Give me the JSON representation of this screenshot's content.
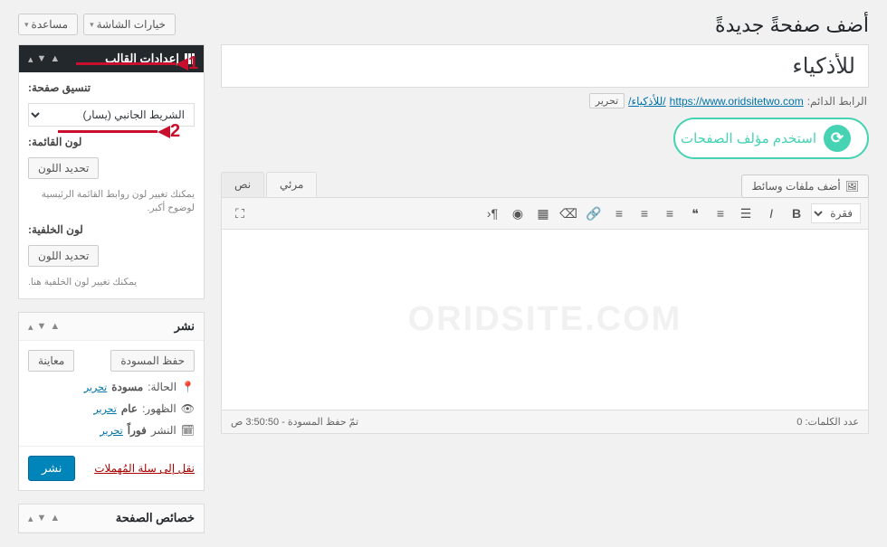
{
  "header": {
    "title_heading": "أضف صفحةً جديدةً",
    "top_buttons": [
      "خيارات الشاشة",
      "مساعدة"
    ]
  },
  "title": {
    "value": "للأذكياء"
  },
  "permalink": {
    "label": "الرابط الدائم:",
    "base_url": "https://www.oridsitetwo.com",
    "slug": "/للأذكياء/",
    "edit_label": "تحرير"
  },
  "builder": {
    "label": "استخدم مؤلف الصفحات"
  },
  "media_button": "أضف ملفات وسائط",
  "editor": {
    "tabs": {
      "visual": "مرئي",
      "text": "نص"
    },
    "format_dropdown": "فقرة",
    "watermark": "ORIDSITE.COM",
    "status": {
      "word_count_label": "عدد الكلمات:",
      "word_count": "0",
      "autosave": "تمّ حفظ المسودة - 3:50:50 ص"
    }
  },
  "sidebar": {
    "theme_settings": {
      "title": "إعدادات القالب",
      "layout_label": "تنسيق صفحة:",
      "layout_option": "الشريط الجانبي (يسار)",
      "menu_color_label": "لون القائمة:",
      "menu_color_button": "تحديد اللون",
      "menu_hint": "يمكنك تغيير لون روابط القائمة الرئيسية لوضوح أكبر.",
      "bg_color_label": "لون الخلفية:",
      "bg_color_button": "تحديد اللون",
      "bg_hint": "يمكنك تغيير لون الخلفية هنا."
    },
    "publish": {
      "title": "نشر",
      "save_draft": "حفظ المسودة",
      "preview": "معاينة",
      "status_label": "الحالة:",
      "status_value": "مسودة",
      "status_edit": "تحرير",
      "visibility_label": "الظهور:",
      "visibility_value": "عام",
      "visibility_edit": "تحرير",
      "schedule_label": "النشر",
      "schedule_value": "فوراً",
      "schedule_edit": "تحرير",
      "trash": "نقل إلى سلة المُهملات",
      "publish_btn": "نشر"
    },
    "page_attrs": {
      "title": "خصائص الصفحة"
    }
  },
  "annotations": {
    "one": "1",
    "two": "2"
  }
}
